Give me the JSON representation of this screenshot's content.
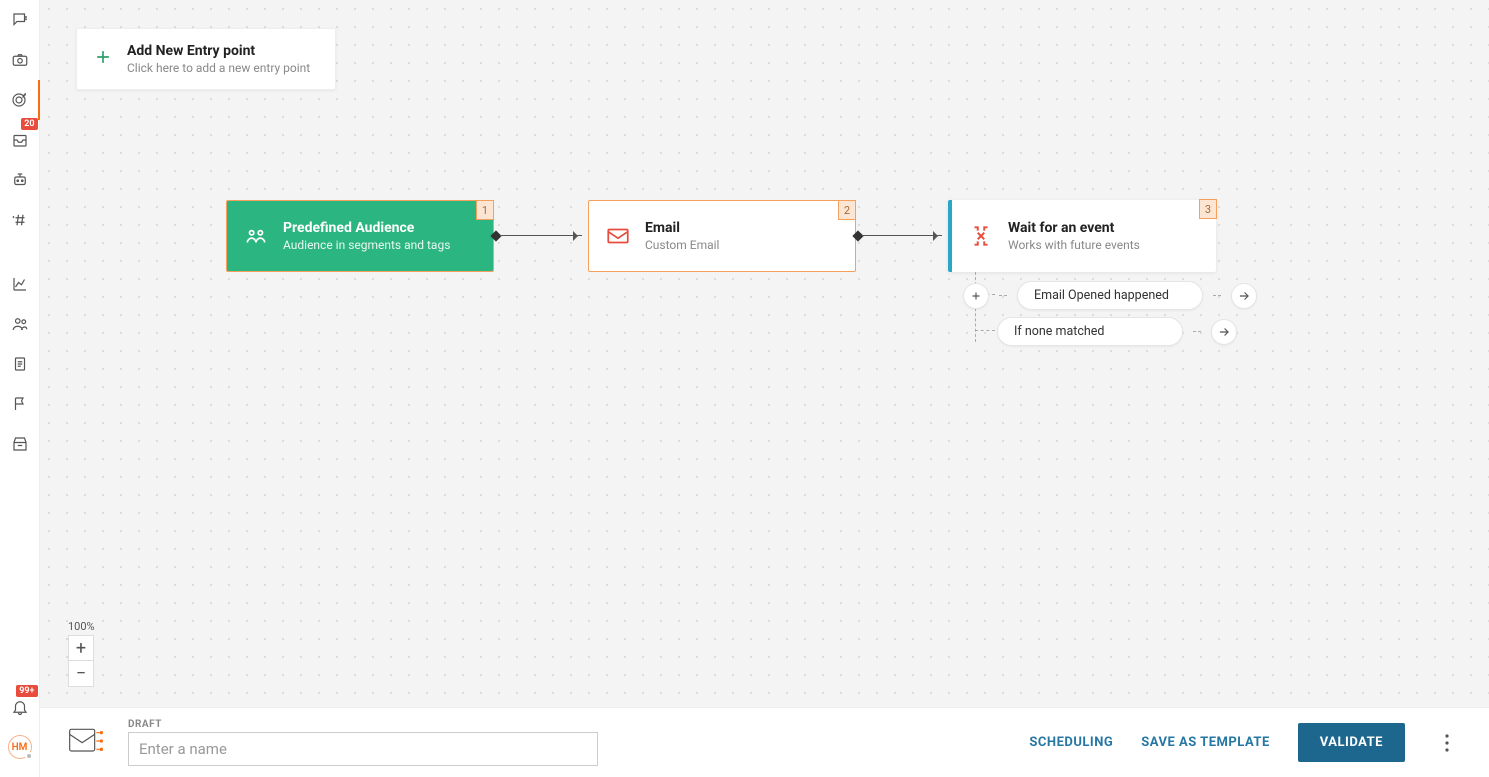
{
  "sidebar": {
    "top_badges": {
      "item4_badge": "20"
    },
    "bottom": {
      "notif_badge": "99+",
      "avatar_initials": "HM"
    }
  },
  "entry_card": {
    "title": "Add New Entry point",
    "subtitle": "Click here to add a new entry point"
  },
  "zoom": {
    "label": "100%"
  },
  "nodes": {
    "n1": {
      "index": "1",
      "title": "Predefined Audience",
      "subtitle": "Audience in segments and tags"
    },
    "n2": {
      "index": "2",
      "title": "Email",
      "subtitle": "Custom Email"
    },
    "n3": {
      "index": "3",
      "title": "Wait for an event",
      "subtitle": "Works with future events"
    }
  },
  "branches": {
    "b1": "Email Opened happened",
    "b2": "If none matched"
  },
  "bottom_bar": {
    "status": "DRAFT",
    "name_placeholder": "Enter a name",
    "scheduling": "SCHEDULING",
    "save_template": "SAVE AS TEMPLATE",
    "validate": "VALIDATE"
  }
}
